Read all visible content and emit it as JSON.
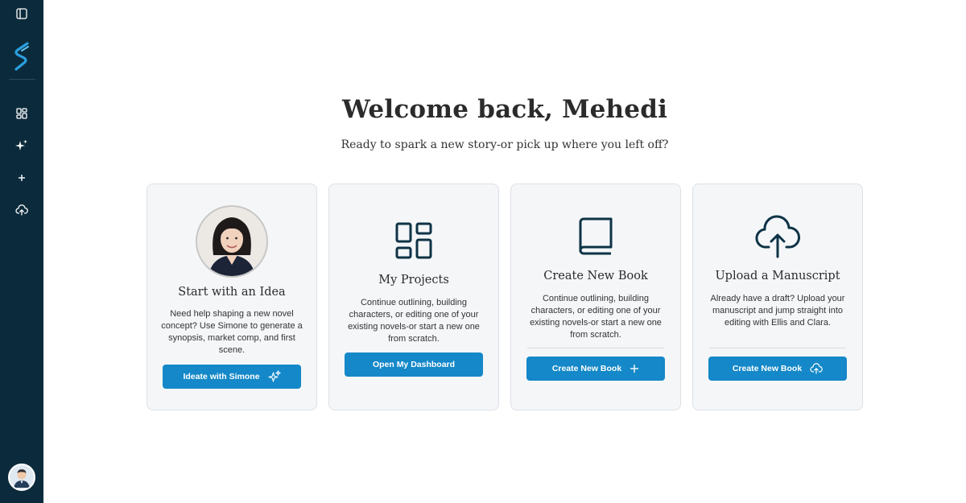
{
  "sidebar": {
    "items": [
      {
        "icon": "sidebar-toggle-icon"
      },
      {
        "icon": "dashboard-grid-icon"
      },
      {
        "icon": "sparkles-icon"
      },
      {
        "icon": "plus-icon"
      },
      {
        "icon": "cloud-upload-icon"
      }
    ],
    "logo_icon": "s-logo-icon",
    "avatar_icon": "user-avatar"
  },
  "main": {
    "welcome": "Welcome back, Mehedi",
    "subtitle": "Ready to spark a new story-or pick up where you left off?"
  },
  "cards": [
    {
      "title": "Start with an Idea",
      "description": "Need help shaping a new novel concept? Use Simone to generate a synopsis, market comp, and first scene.",
      "button": "Ideate with Simone",
      "icon": "simone-avatar"
    },
    {
      "title": "My Projects",
      "description": "Continue outlining, building characters, or editing one of your existing novels-or start a new one from scratch.",
      "button": "Open My Dashboard",
      "icon": "dashboard-grid-icon"
    },
    {
      "title": "Create New Book",
      "description": "Continue outlining, building characters, or editing one of your existing novels-or start a new one from scratch.",
      "button": "Create New Book",
      "icon": "book-icon"
    },
    {
      "title": "Upload a Manuscript",
      "description": "Already have a draft? Upload your manuscript and jump straight into editing with Ellis and Clara.",
      "button": "Create New Book",
      "icon": "cloud-upload-icon"
    }
  ],
  "colors": {
    "sidebar_bg": "#0b2b3c",
    "accent": "#1488c8",
    "card_bg": "#f4f6f8",
    "icon_dark": "#0e3346"
  }
}
